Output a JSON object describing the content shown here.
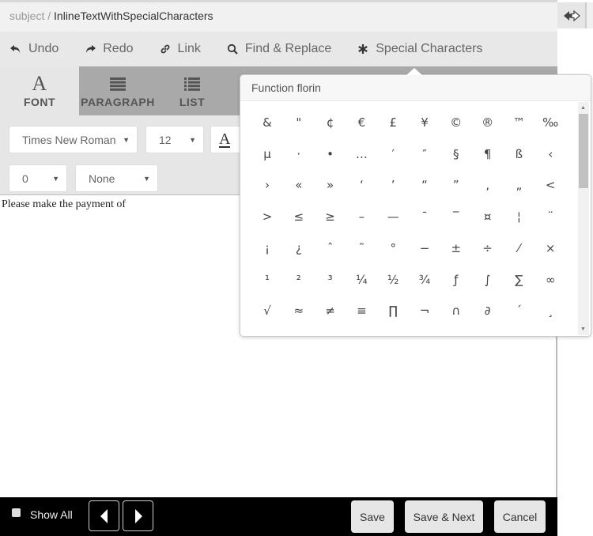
{
  "breadcrumb": {
    "parent": "subject /",
    "current": "InlineTextWithSpecialCharacters"
  },
  "toolbar": {
    "items": [
      {
        "label": "Undo",
        "icon": "undo-icon"
      },
      {
        "label": "Redo",
        "icon": "redo-icon"
      },
      {
        "label": "Link",
        "icon": "link-icon"
      },
      {
        "label": "Find & Replace",
        "icon": "search-icon"
      },
      {
        "label": "Special Characters",
        "icon": "asterisk-icon"
      }
    ]
  },
  "tabs": [
    {
      "label": "FONT",
      "icon": "font-icon",
      "glyph": "A",
      "active": true
    },
    {
      "label": "PARAGRAPH",
      "icon": "align-icon"
    },
    {
      "label": "LIST",
      "icon": "list-icon"
    }
  ],
  "font_options": {
    "font_family": "Times New Roman",
    "font_size": "12",
    "color_glyph": "A",
    "spacing": "0",
    "decoration": "None"
  },
  "editor": {
    "content": "Please make the payment of"
  },
  "special_chars": {
    "hover_label": "Function florin",
    "rows": [
      [
        "&",
        "\"",
        "¢",
        "€",
        "£",
        "¥",
        "©",
        "®",
        "™",
        "‰"
      ],
      [
        "µ",
        "·",
        "•",
        "…",
        "′",
        "″",
        "§",
        "¶",
        "ß",
        "‹"
      ],
      [
        "›",
        "«",
        "»",
        "‘",
        "’",
        "“",
        "”",
        "‚",
        "„",
        "<"
      ],
      [
        ">",
        "≤",
        "≥",
        "–",
        "—",
        "¯",
        "‾",
        "¤",
        "¦",
        "¨"
      ],
      [
        "¡",
        "¿",
        "ˆ",
        "˜",
        "°",
        "−",
        "±",
        "÷",
        "⁄",
        "×"
      ],
      [
        "¹",
        "²",
        "³",
        "¼",
        "½",
        "¾",
        "ƒ",
        "∫",
        "∑",
        "∞"
      ],
      [
        "√",
        "≈",
        "≠",
        "≡",
        "∏",
        "¬",
        "∩",
        "∂",
        "´",
        "¸"
      ]
    ]
  },
  "footer": {
    "show_all_label": "Show All",
    "save_label": "Save",
    "save_next_label": "Save & Next",
    "cancel_label": "Cancel"
  }
}
